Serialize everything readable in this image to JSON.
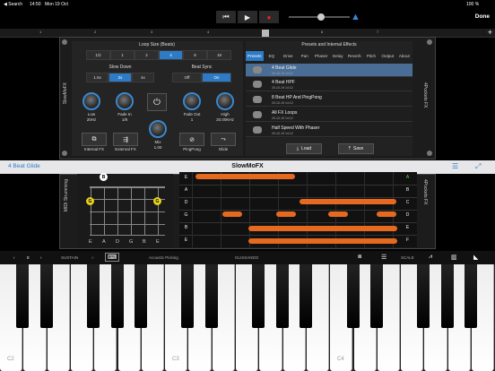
{
  "status_bar": {
    "back_label": "◀ Search",
    "time": "14:50",
    "date": "Mon 19 Oct",
    "battery": "100 %"
  },
  "transport": {
    "rewind_icon": "rewind-icon",
    "play_icon": "play-icon",
    "record_icon": "record-icon",
    "metronome_icon": "metronome-icon",
    "done_label": "Done"
  },
  "ruler": {
    "marks": [
      "1",
      "2",
      "3",
      "4",
      "5",
      "6",
      "7"
    ],
    "add_label": "+"
  },
  "plugin": {
    "side_label_left": "SlowMoFX",
    "side_label_right": "4Pockets FX",
    "loop_size": {
      "title": "Loop Size (Beats)",
      "options": [
        "1/2",
        "1",
        "2",
        "4",
        "8",
        "16"
      ],
      "selected": "4"
    },
    "slow_down": {
      "title": "Slow Down",
      "options": [
        "1.5x",
        "2x",
        "4x"
      ],
      "selected": "2x"
    },
    "beat_sync": {
      "title": "Beat Sync",
      "options": [
        "Off",
        "On"
      ],
      "selected": "On"
    },
    "knobs": [
      {
        "name": "Low",
        "value": "20Hz"
      },
      {
        "name": "Fade In",
        "value": "1/8"
      },
      {
        "name": "Mix",
        "value": "1.00"
      },
      {
        "name": "Fade Out",
        "value": "1"
      },
      {
        "name": "High",
        "value": "20.00KHz"
      }
    ],
    "buttons": {
      "internal_fx": "Internal FX",
      "external_fx": "External FX",
      "pingpong": "PingPong",
      "glide": "Glide"
    },
    "colors": {
      "accent": "#2d7bc6",
      "note": "#e56a1f"
    }
  },
  "presets": {
    "title": "Presets and Internal Effects",
    "tabs": [
      "Presets",
      "EQ",
      "Drive",
      "Pan",
      "Phaser",
      "Delay",
      "Reverb",
      "Pitch",
      "Output",
      "About"
    ],
    "active_tab": "Presets",
    "items": [
      {
        "name": "4 Beat Glide",
        "date": "20-10-19 14:12"
      },
      {
        "name": "4 Beat HPF",
        "date": "20-10-19 14:12"
      },
      {
        "name": "8 Beat HP And PingPong",
        "date": "20-10-19 14:12"
      },
      {
        "name": "All FX Loops",
        "date": "20-10-19 14:12"
      },
      {
        "name": "Half Speed With Phaser",
        "date": "20-10-19 14:12"
      }
    ],
    "selected": "4 Beat Glide",
    "load_label": "Load",
    "save_label": "Save"
  },
  "titlebar": {
    "preset_name": "4 Beat Glide",
    "plugin_name": "SlowMoFX"
  },
  "midi": {
    "side_label_left": "MIDI Strumming",
    "side_label_right": "4Pockets FX",
    "fret_dots": [
      "B",
      "G",
      "G"
    ],
    "strings": [
      "E",
      "A",
      "D",
      "G",
      "B",
      "E"
    ],
    "rows": [
      "E",
      "A",
      "D",
      "G",
      "B",
      "E"
    ],
    "rows_right": [
      "A",
      "B",
      "C",
      "D",
      "E",
      "F"
    ]
  },
  "keyboard_bar": {
    "octave": "0",
    "sustain": "SUSTAIN",
    "instrument": "Acoustic Picking",
    "glissando": "GLISSANDO",
    "scale": "SCALE"
  },
  "keyboard": {
    "labels": [
      "C2",
      "C3",
      "C4"
    ]
  }
}
